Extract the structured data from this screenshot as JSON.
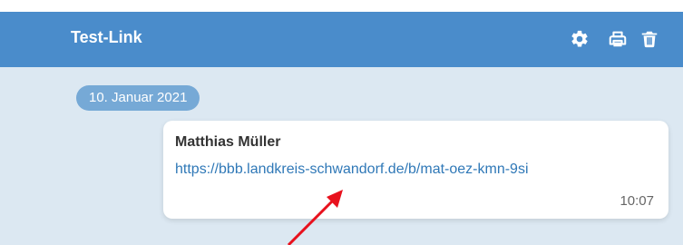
{
  "header": {
    "title": "Test-Link",
    "icons": [
      "gear-icon",
      "print-icon",
      "trash-icon"
    ],
    "color": "#4a8ccb"
  },
  "chat": {
    "background": "#dce8f2",
    "date_chip": "10. Januar 2021",
    "message": {
      "sender": "Matthias Müller",
      "link": "https://bbb.landkreis-schwandorf.de/b/mat-oez-kmn-9si",
      "time": "10:07"
    }
  },
  "annotation": {
    "arrow_color": "#e8111d"
  }
}
